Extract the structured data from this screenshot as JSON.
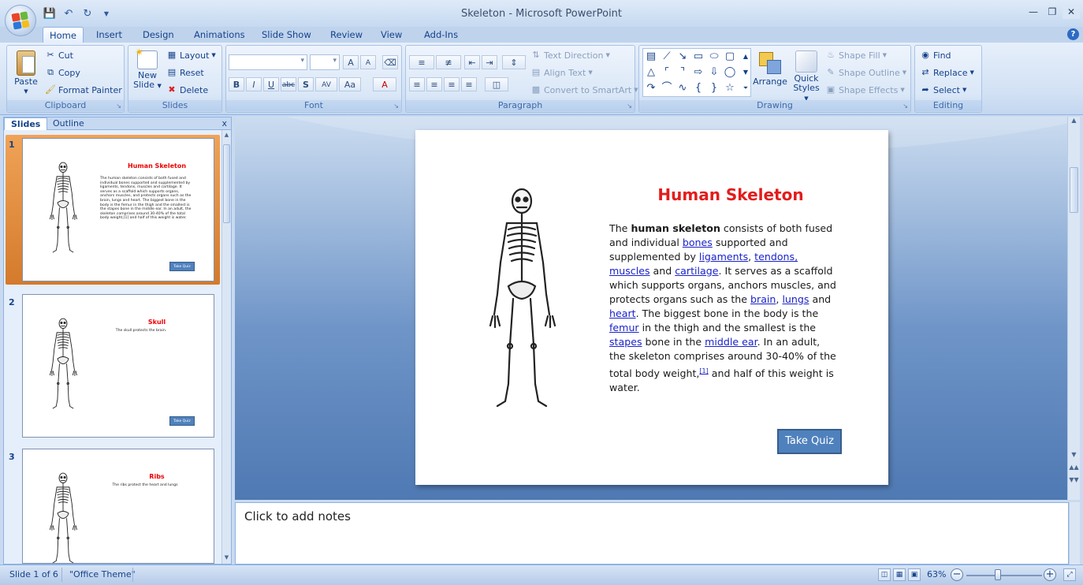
{
  "window": {
    "title": "Skeleton - Microsoft PowerPoint"
  },
  "qat": {
    "save_icon": "save-icon",
    "undo_icon": "undo-icon",
    "redo_icon": "redo-icon",
    "customize_icon": "chevron-down-icon"
  },
  "tabs": [
    {
      "label": "Home",
      "active": true
    },
    {
      "label": "Insert"
    },
    {
      "label": "Design"
    },
    {
      "label": "Animations"
    },
    {
      "label": "Slide Show"
    },
    {
      "label": "Review"
    },
    {
      "label": "View"
    },
    {
      "label": "Add-Ins"
    }
  ],
  "ribbon": {
    "clipboard": {
      "label": "Clipboard",
      "paste": "Paste",
      "cut": "Cut",
      "copy": "Copy",
      "format_painter": "Format Painter"
    },
    "slides": {
      "label": "Slides",
      "new_slide_line1": "New",
      "new_slide_line2": "Slide",
      "layout": "Layout",
      "reset": "Reset",
      "delete": "Delete"
    },
    "font": {
      "label": "Font",
      "bold": "B",
      "italic": "I",
      "underline": "U",
      "strike": "abc",
      "shadow": "S",
      "spacing": "AV",
      "case": "Aa",
      "grow": "A",
      "shrink": "A",
      "color": "A"
    },
    "paragraph": {
      "label": "Paragraph",
      "text_direction": "Text Direction",
      "align_text": "Align Text",
      "convert_smartart": "Convert to SmartArt"
    },
    "drawing": {
      "label": "Drawing",
      "arrange": "Arrange",
      "quick_styles_line1": "Quick",
      "quick_styles_line2": "Styles",
      "shape_fill": "Shape Fill",
      "shape_outline": "Shape Outline",
      "shape_effects": "Shape Effects"
    },
    "editing": {
      "label": "Editing",
      "find": "Find",
      "replace": "Replace",
      "select": "Select"
    }
  },
  "panel": {
    "tab_slides": "Slides",
    "tab_outline": "Outline",
    "close": "x"
  },
  "thumbnails": [
    {
      "num": "1",
      "title": "Human Skeleton",
      "body": "The human skeleton consists of both fused and individual bones supported and supplemented by ligaments, tendons, muscles and cartilage. It serves as a scaffold which supports organs, anchors muscles, and protects organs such as the brain, lungs and heart. The biggest bone in the body is the femur in the thigh and the smallest is the stapes bone in the middle ear. In an adult, the skeleton comprises around 30-40% of the total body weight,[1] and half of this weight is water.",
      "button": "Take Quiz",
      "selected": true
    },
    {
      "num": "2",
      "title": "Skull",
      "body": "The skull protects the brain.",
      "button": "Take Quiz"
    },
    {
      "num": "3",
      "title": "Ribs",
      "body": "The ribs protect the heart and lungs",
      "button": ""
    }
  ],
  "slide": {
    "title": "Human Skeleton",
    "body": {
      "t1": "The ",
      "bold": "human skeleton",
      "t2": " consists of both fused and individual  ",
      "l_bones": "bones",
      "t3": " supported and supplemented by ",
      "l_ligaments": "ligaments",
      "t4": ", ",
      "l_tendons": "tendons,",
      "t5": " ",
      "l_muscles": "muscles",
      "t6": " and ",
      "l_cartilage": "cartilage",
      "t7": ". It serves as a scaffold which supports organs, anchors muscles, and protects organs such as the ",
      "l_brain": "brain",
      "t8": ", ",
      "l_lungs": "lungs",
      "t9": " and ",
      "l_heart": "heart",
      "t10": ". The biggest bone in the body is the ",
      "l_femur": "femur",
      "t11": " in the thigh and the smallest is the ",
      "l_stapes": "stapes",
      "t12": " bone in the ",
      "l_middle_ear": "middle ear",
      "t13": ". In an adult, the skeleton comprises around 30-40% of the total body weight,",
      "ref": "[1]",
      "t14": " and half of this weight is water."
    },
    "button": "Take Quiz"
  },
  "notes": {
    "placeholder": "Click to add notes"
  },
  "status": {
    "slide_counter": "Slide 1 of 6",
    "theme": "\"Office Theme\"",
    "zoom": "63%",
    "zoom_fraction": 0.42
  },
  "colors": {
    "title_red": "#e31c1c",
    "button_blue": "#4f81bd",
    "link_blue": "#1a22c8",
    "selection_orange": "#e58d3c"
  }
}
